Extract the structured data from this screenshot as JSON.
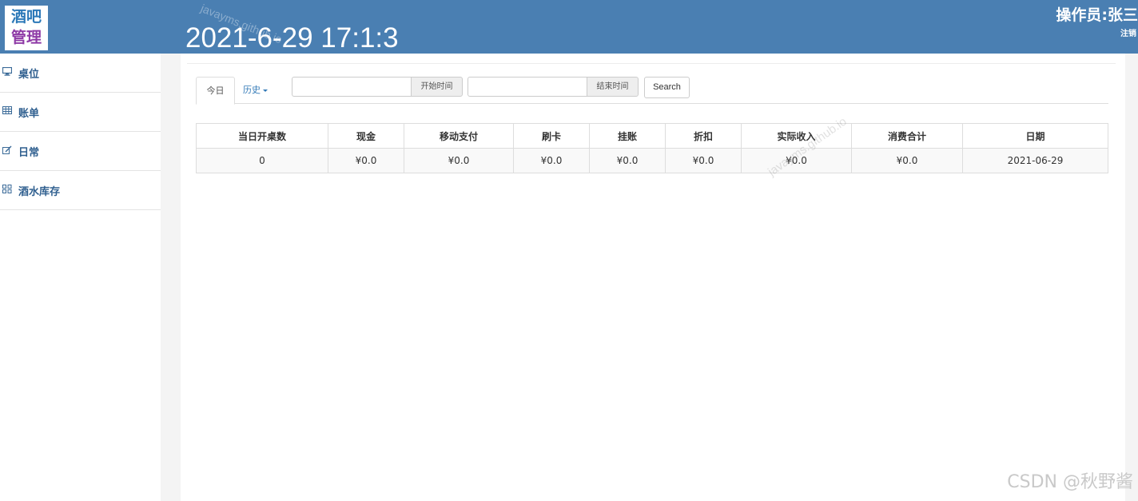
{
  "header": {
    "logo_line1": "酒吧",
    "logo_line2": "管理",
    "clock": "2021-6-29 17:1:3",
    "operator": "操作员:张三",
    "logout": "注销",
    "bg_color": "#4a7fb2"
  },
  "sidebar": {
    "items": [
      {
        "label": "桌位",
        "icon": "monitor-icon",
        "glyph": "▭"
      },
      {
        "label": "账单",
        "icon": "table-icon",
        "glyph": "▦"
      },
      {
        "label": "日常",
        "icon": "edit-icon",
        "glyph": "✎"
      },
      {
        "label": "酒水库存",
        "icon": "grid-icon",
        "glyph": "▦"
      }
    ]
  },
  "tabs": {
    "today": "今日",
    "history": "历史"
  },
  "filters": {
    "start_value": "",
    "start_addon": "开始时间",
    "end_value": "",
    "end_addon": "结束时间",
    "search_label": "Search"
  },
  "table": {
    "headers": [
      "当日开桌数",
      "现金",
      "移动支付",
      "刷卡",
      "挂账",
      "折扣",
      "实际收入",
      "消费合计",
      "日期"
    ],
    "rows": [
      [
        "0",
        "¥0.0",
        "¥0.0",
        "¥0.0",
        "¥0.0",
        "¥0.0",
        "¥0.0",
        "¥0.0",
        "2021-06-29"
      ]
    ]
  },
  "watermarks": {
    "wm1": "javayms.github.io",
    "wm2": "javayms.github.io",
    "csdn": "CSDN @秋野酱"
  }
}
